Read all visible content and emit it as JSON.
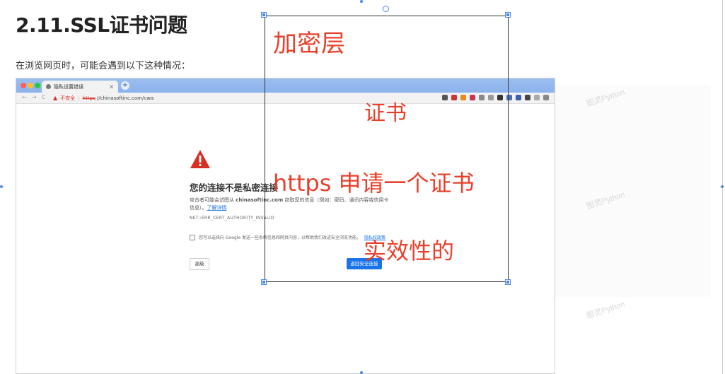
{
  "doc": {
    "title": "2.11.SSL证书问题",
    "intro": "在浏览网页时，可能会遇到以下这种情况："
  },
  "browser": {
    "tab_title": "隐私设置错误",
    "tab_close": "×",
    "new_tab": "+",
    "nav_back": "←",
    "nav_forward": "→",
    "nav_reload": "C",
    "insecure_label": "不安全",
    "url_scheme": "https",
    "url_rest": "://chinasoftinc.com/cwa",
    "ext_colors": [
      "#555555",
      "#cc3333",
      "#e88a1a",
      "#cc3355",
      "#888888",
      "#999999",
      "#333333",
      "#4a6fb5",
      "#3b5fb0",
      "#444444",
      "#aaaaaa",
      "#888888"
    ]
  },
  "error_page": {
    "heading": "您的连接不是私密连接",
    "desc_prefix": "攻击者可能会试图从 ",
    "desc_host": "chinasoftinc.com",
    "desc_mid": " 窃取您的信息（例如：密码、通讯内容或信用卡信息）。",
    "desc_link": "了解详情",
    "error_code": "NET::ERR_CERT_AUTHORITY_INVALID",
    "checkbox_text": "您可以选择向 Google 发送一些系统信息和网页内容，以帮助我们改进安全浏览功能。",
    "checkbox_link": "隐私权政策",
    "advanced_button": "高级",
    "back_button": "返回安全连接"
  },
  "annotations": {
    "line1": "加密层",
    "line2": "证书",
    "line3": "https 申请一个证书",
    "line4": "实效性的"
  },
  "watermark": "图灵Python",
  "colors": {
    "annotation": "#e8402a",
    "handle": "#4a86e8",
    "link": "#1a73e8",
    "error_red": "#d93025"
  }
}
